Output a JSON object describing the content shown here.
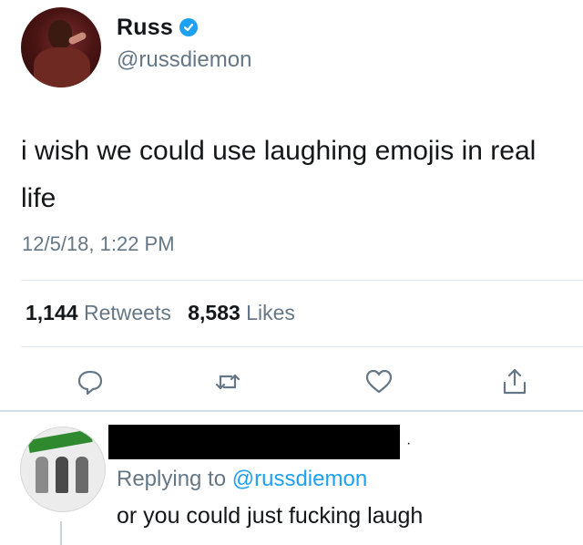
{
  "tweet": {
    "author": {
      "display_name": "Russ",
      "handle": "@russdiemon",
      "verified": true
    },
    "text": "i wish we could use laughing emojis in real life",
    "timestamp": "12/5/18, 1:22 PM",
    "stats": {
      "retweets_count": "1,144",
      "retweets_label": "Retweets",
      "likes_count": "8,583",
      "likes_label": "Likes"
    },
    "actions": [
      {
        "name": "reply",
        "icon": "reply-icon"
      },
      {
        "name": "retweet",
        "icon": "retweet-icon"
      },
      {
        "name": "like",
        "icon": "heart-icon"
      },
      {
        "name": "share",
        "icon": "share-icon"
      }
    ]
  },
  "reply": {
    "author_redacted": true,
    "replying_prefix": "Replying to",
    "replying_to": "@russdiemon",
    "text": "or you could just fucking laugh"
  },
  "colors": {
    "accent": "#1da1f2",
    "secondary_text": "#657786",
    "divider": "#e1e8ed"
  }
}
